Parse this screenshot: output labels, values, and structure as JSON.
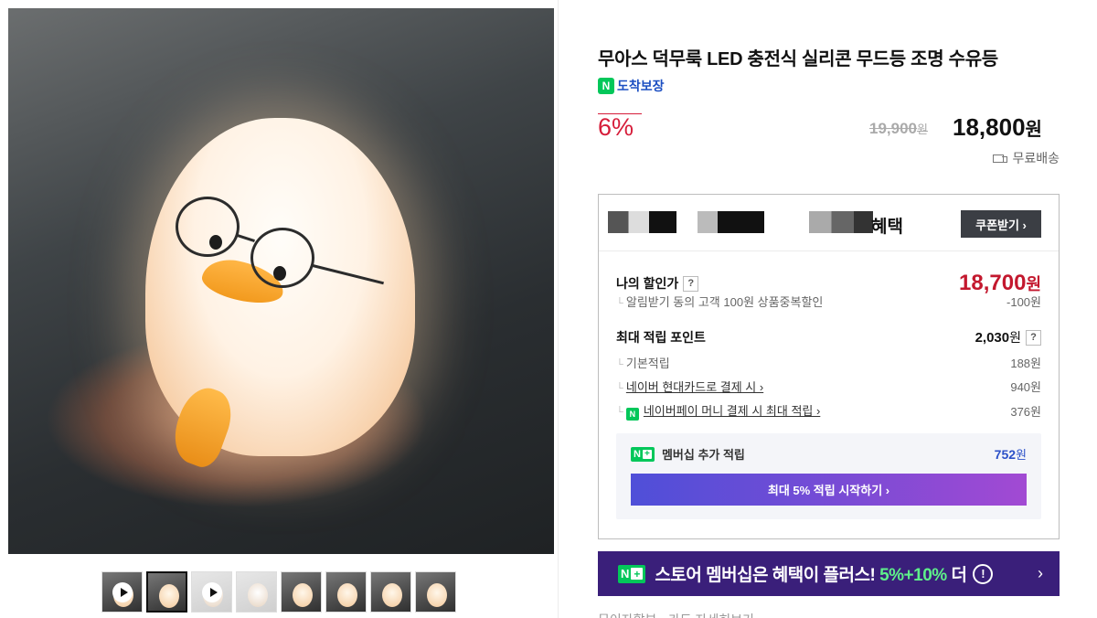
{
  "product": {
    "title": "무아스 덕무룩 LED 충전식 실리콘 무드등 조명 수유등",
    "delivery_badge_n": "N",
    "delivery_badge": "도착보장",
    "discount": "6%",
    "original_price": "19,900",
    "original_price_unit": "원",
    "sale_price": "18,800",
    "sale_price_unit": "원",
    "shipping": "무료배송"
  },
  "thumbnails": [
    {
      "video": true
    },
    {
      "video": false,
      "selected": true
    },
    {
      "video": true
    },
    {
      "video": false
    },
    {
      "video": false
    },
    {
      "video": false
    },
    {
      "video": false
    },
    {
      "video": false
    }
  ],
  "benefit": {
    "title": "혜택",
    "coupon_button": "쿠폰받기 ›",
    "my_price_label": "나의 할인가",
    "my_price": "18,700",
    "my_price_unit": "원",
    "my_price_sub": "알림받기 동의 고객 100원 상품중복할인",
    "my_price_sub_value": "-100원",
    "points_label": "최대 적립 포인트",
    "points_value": "2,030",
    "points_unit": "원",
    "basic_label": "기본적립",
    "basic_value": "188원",
    "card_label": "네이버 현대카드로 결제 시 ›",
    "card_value": "940원",
    "pay_label": "네이버페이 머니 결제 시 최대 적립 ›",
    "pay_value": "376원",
    "help_mark": "?"
  },
  "membership": {
    "label": "멤버십 추가 적립",
    "value": "752",
    "unit": "원",
    "button": "최대 5% 적립 시작하기 ›"
  },
  "banner": {
    "text_before": "스토어 멤버십은 혜택이 플러스! ",
    "highlight": "5%+10%",
    "text_after": " 더",
    "info": "!",
    "arrow": "›"
  },
  "bottom_cut_text": "무이자할부 · 카드 자세히보기"
}
